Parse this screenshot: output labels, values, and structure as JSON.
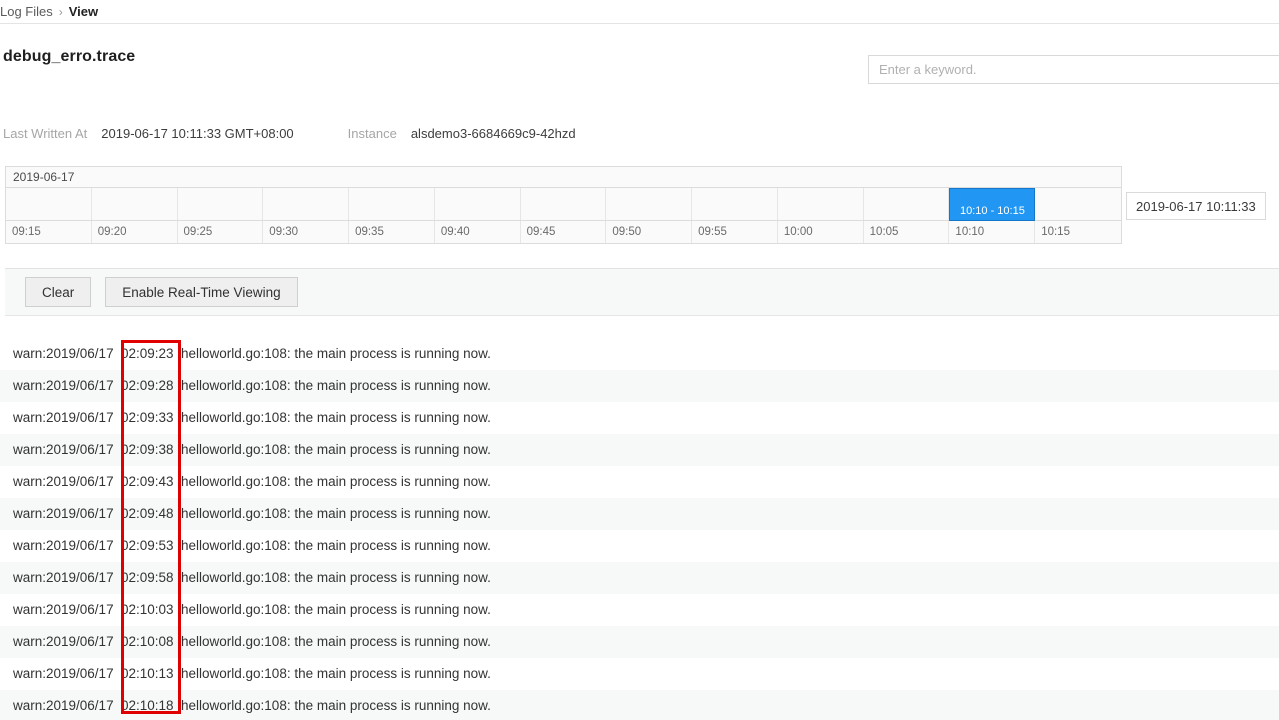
{
  "breadcrumb": {
    "root": "Log Files",
    "separator": "›",
    "current": "View"
  },
  "header": {
    "file_name": "debug_erro.trace"
  },
  "search": {
    "placeholder": "Enter a keyword.",
    "value": ""
  },
  "meta": {
    "last_written_label": "Last Written At",
    "last_written_value": "2019-06-17 10:11:33 GMT+08:00",
    "instance_label": "Instance",
    "instance_value": "alsdemo3-6684669c9-42hzd"
  },
  "timeline": {
    "date": "2019-06-17",
    "ticks": [
      "09:15",
      "09:20",
      "09:25",
      "09:30",
      "09:35",
      "09:40",
      "09:45",
      "09:50",
      "09:55",
      "10:00",
      "10:05",
      "10:10",
      "10:15"
    ],
    "selected_block": {
      "label": "10:10 - 10:15",
      "column_index": 11,
      "color": "#2196f3"
    },
    "tooltip": "2019-06-17 10:11:33"
  },
  "toolbar": {
    "clear_label": "Clear",
    "realtime_label": "Enable Real-Time Viewing"
  },
  "annotation": {
    "highlight_color": "#e00000"
  },
  "log": {
    "rows": [
      {
        "prefix": "warn:2019/06/17",
        "time": "02:09:23",
        "message": "helloworld.go:108: the main process is running now."
      },
      {
        "prefix": "warn:2019/06/17",
        "time": "02:09:28",
        "message": "helloworld.go:108: the main process is running now."
      },
      {
        "prefix": "warn:2019/06/17",
        "time": "02:09:33",
        "message": "helloworld.go:108: the main process is running now."
      },
      {
        "prefix": "warn:2019/06/17",
        "time": "02:09:38",
        "message": "helloworld.go:108: the main process is running now."
      },
      {
        "prefix": "warn:2019/06/17",
        "time": "02:09:43",
        "message": "helloworld.go:108: the main process is running now."
      },
      {
        "prefix": "warn:2019/06/17",
        "time": "02:09:48",
        "message": "helloworld.go:108: the main process is running now."
      },
      {
        "prefix": "warn:2019/06/17",
        "time": "02:09:53",
        "message": "helloworld.go:108: the main process is running now."
      },
      {
        "prefix": "warn:2019/06/17",
        "time": "02:09:58",
        "message": "helloworld.go:108: the main process is running now."
      },
      {
        "prefix": "warn:2019/06/17",
        "time": "02:10:03",
        "message": "helloworld.go:108: the main process is running now."
      },
      {
        "prefix": "warn:2019/06/17",
        "time": "02:10:08",
        "message": "helloworld.go:108: the main process is running now."
      },
      {
        "prefix": "warn:2019/06/17",
        "time": "02:10:13",
        "message": "helloworld.go:108: the main process is running now."
      },
      {
        "prefix": "warn:2019/06/17",
        "time": "02:10:18",
        "message": "helloworld.go:108: the main process is running now."
      }
    ]
  }
}
